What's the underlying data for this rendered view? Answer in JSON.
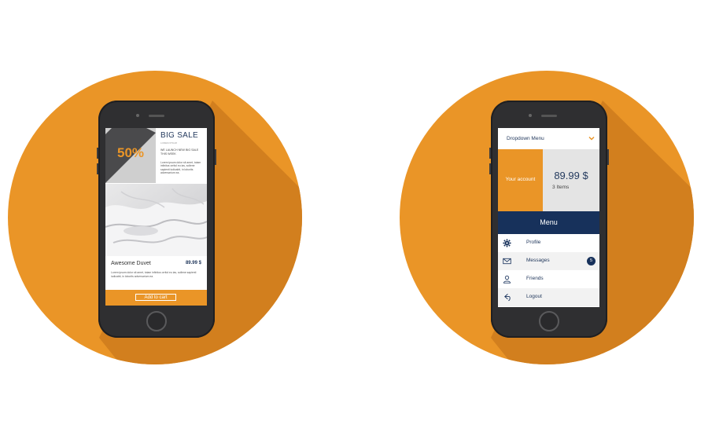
{
  "colors": {
    "orange": "#EA9527",
    "orange_shadow": "#D27F1E",
    "navy": "#17315b",
    "phone_body": "#2f2f31"
  },
  "left_phone": {
    "sale_percent": "50%",
    "sale_title": "BIG SALE",
    "sale_subtitle": "LOREM IPSUM",
    "sale_description": "WE LAUNCH NEW BIG SALE THIS WEEK",
    "sale_body": "Lorem ipsum dolor sit amet, totam infinitus orritol eu ias, sollene sapienti iudicabit, in loborits adversarium ea.",
    "product_image": "duvet-photo",
    "product_name": "Awesome Duvet",
    "product_price": "89.99 $",
    "product_description": "Lorem ipsum dolor sit amet, totam infinitus orritol eu ias, sollene sapienti iudicabit, in loborits adversarium ea.",
    "add_to_cart": "Add to cart"
  },
  "right_phone": {
    "dropdown_label": "Dropdown Menu",
    "dropdown_icon": "chevron-down-icon",
    "account_label": "Your account",
    "price": "89.99 $",
    "items": "3 Items",
    "menu_label": "Menu",
    "menu_items": [
      {
        "label": "Profile",
        "icon": "gear-icon"
      },
      {
        "label": "Messages",
        "icon": "envelope-icon",
        "badge": "5"
      },
      {
        "label": "Friends",
        "icon": "user-icon"
      },
      {
        "label": "Logout",
        "icon": "logout-icon"
      }
    ]
  }
}
